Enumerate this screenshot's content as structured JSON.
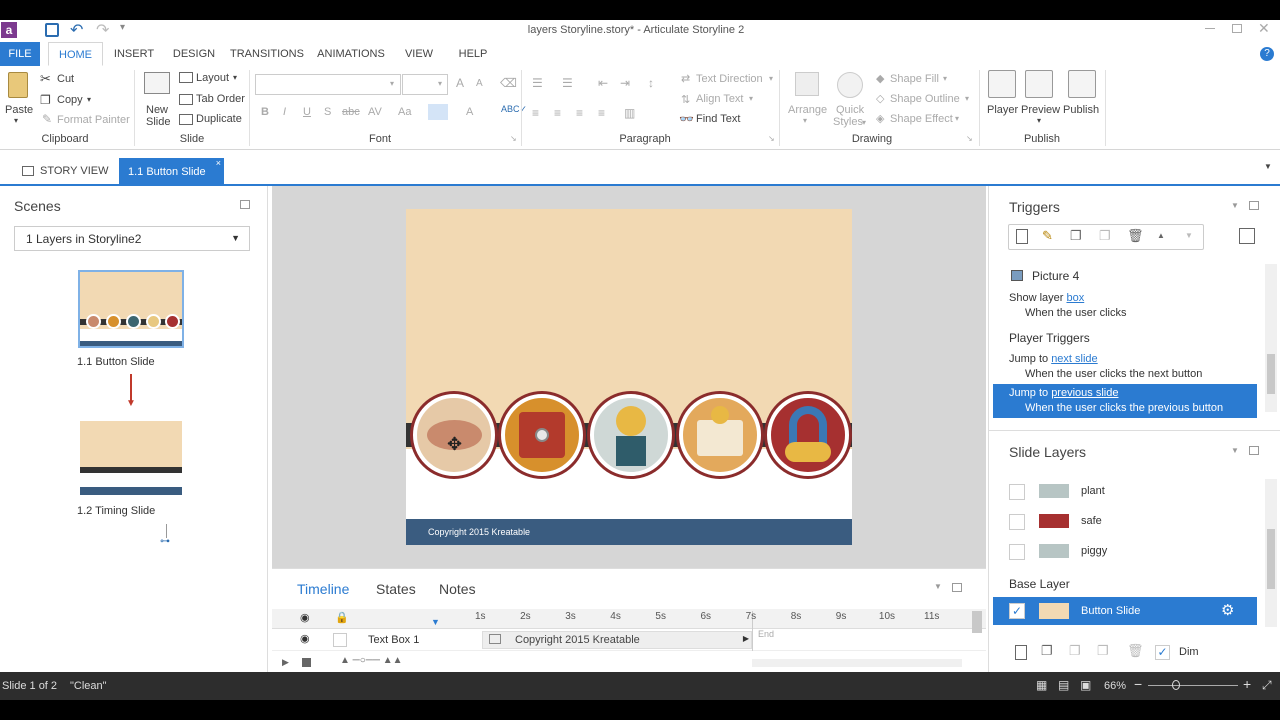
{
  "window": {
    "title": "layers Storyline.story* - Articulate Storyline 2"
  },
  "ribbon_tabs": [
    "FILE",
    "HOME",
    "INSERT",
    "DESIGN",
    "TRANSITIONS",
    "ANIMATIONS",
    "VIEW",
    "HELP"
  ],
  "ribbon": {
    "clipboard": {
      "paste": "Paste",
      "cut": "Cut",
      "copy": "Copy",
      "format_painter": "Format Painter",
      "label": "Clipboard"
    },
    "slide": {
      "new_slide_1": "New",
      "new_slide_2": "Slide",
      "layout": "Layout",
      "tab_order": "Tab Order",
      "duplicate": "Duplicate",
      "label": "Slide"
    },
    "font": {
      "label": "Font"
    },
    "paragraph": {
      "text_direction": "Text Direction",
      "align_text": "Align Text",
      "find_text": "Find Text",
      "label": "Paragraph"
    },
    "drawing": {
      "arrange": "Arrange",
      "quick_styles_1": "Quick",
      "quick_styles_2": "Styles",
      "shape_fill": "Shape Fill",
      "shape_outline": "Shape Outline",
      "shape_effect": "Shape Effect",
      "label": "Drawing"
    },
    "publish": {
      "player": "Player",
      "preview": "Preview",
      "publish": "Publish",
      "label": "Publish"
    }
  },
  "doc_tabs": {
    "story_view": "STORY VIEW",
    "active": "1.1 Button Slide"
  },
  "scenes": {
    "title": "Scenes",
    "selected_scene": "1 Layers in Storyline2",
    "slides": [
      {
        "label": "1.1 Button Slide"
      },
      {
        "label": "1.2 Timing Slide"
      }
    ]
  },
  "canvas": {
    "footer": "Copyright 2015 Kreatable"
  },
  "timeline": {
    "tabs": [
      "Timeline",
      "States",
      "Notes"
    ],
    "ticks": [
      "1s",
      "2s",
      "3s",
      "4s",
      "5s",
      "6s",
      "7s",
      "8s",
      "9s",
      "10s",
      "11s"
    ],
    "row_name": "Text Box 1",
    "row_bar": "Copyright 2015 Kreatable",
    "end_label": "End"
  },
  "triggers": {
    "title": "Triggers",
    "object": "Picture 4",
    "t1_action": "Show layer ",
    "t1_link": "box",
    "t1_cond": "When the user clicks",
    "player_triggers": "Player Triggers",
    "t2_action": "Jump to ",
    "t2_link": "next slide",
    "t2_cond": "When the user clicks the next button",
    "t3_action": "Jump to ",
    "t3_link": "previous slide",
    "t3_cond": "When the user clicks the previous button"
  },
  "layers": {
    "title": "Slide Layers",
    "items": [
      {
        "name": "plant"
      },
      {
        "name": "safe"
      },
      {
        "name": "piggy"
      }
    ],
    "base_label": "Base Layer",
    "base_name": "Button Slide",
    "dim": "Dim"
  },
  "status": {
    "slide": "Slide 1 of 2",
    "theme": "\"Clean\"",
    "zoom": "66%"
  },
  "colors": {
    "accent": "#2b7bd1",
    "canvas_bg": "#f2d9b3",
    "footer": "#3a5c80",
    "dark_band": "#333333",
    "ring": "#8b2c2c"
  }
}
